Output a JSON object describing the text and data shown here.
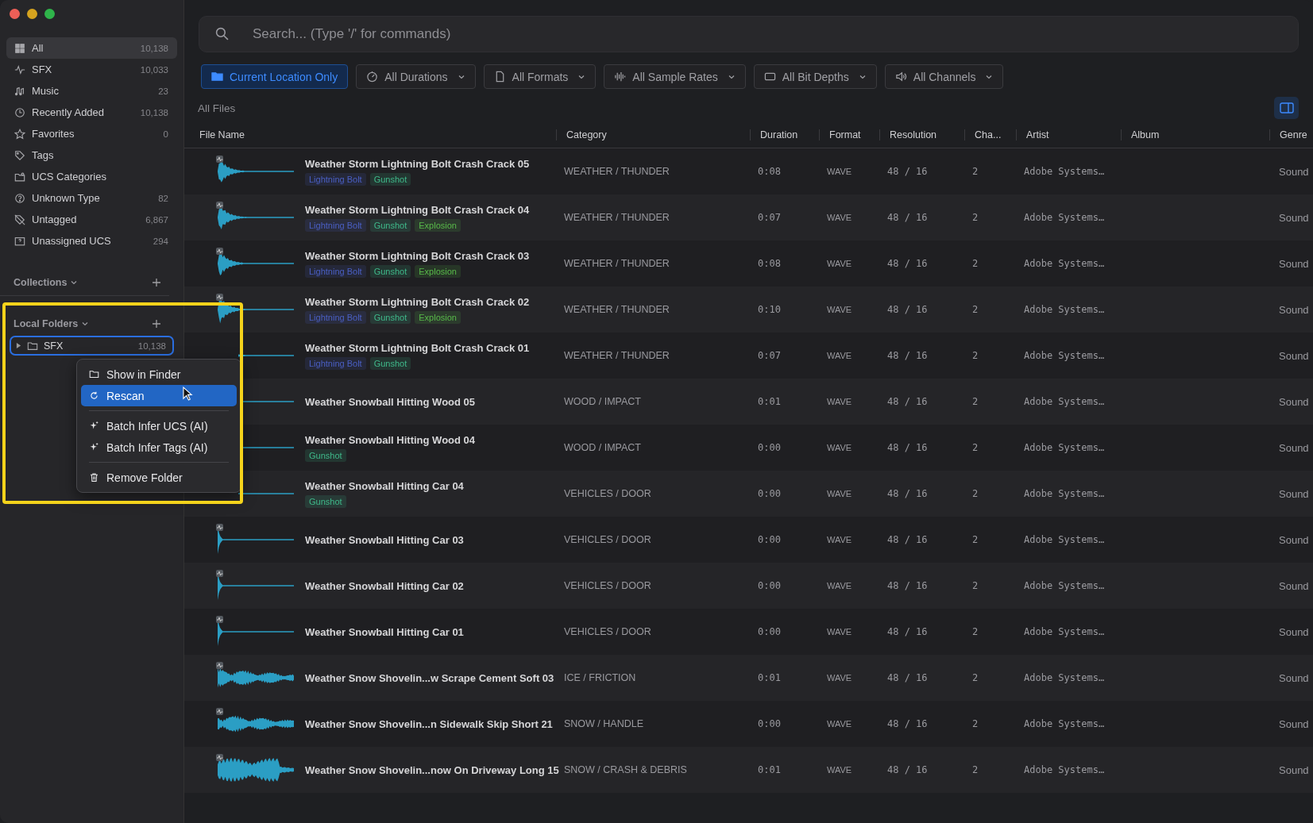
{
  "sidebar": {
    "items": [
      {
        "label": "All",
        "count": "10,138",
        "selected": true
      },
      {
        "label": "SFX",
        "count": "10,033",
        "selected": false
      },
      {
        "label": "Music",
        "count": "23",
        "selected": false
      },
      {
        "label": "Recently Added",
        "count": "10,138",
        "selected": false
      },
      {
        "label": "Favorites",
        "count": "0",
        "selected": false
      },
      {
        "label": "Tags",
        "selected": false
      },
      {
        "label": "UCS Categories",
        "selected": false
      },
      {
        "label": "Unknown Type",
        "count": "82",
        "selected": false
      },
      {
        "label": "Untagged",
        "count": "6,867",
        "selected": false
      },
      {
        "label": "Unassigned UCS",
        "count": "294",
        "selected": false
      }
    ],
    "collections": {
      "title": "Collections"
    },
    "local_folders": {
      "title": "Local Folders",
      "folders": [
        {
          "label": "SFX",
          "count": "10,138",
          "selected": true,
          "expanded": false
        }
      ]
    }
  },
  "context_menu": {
    "groups": [
      [
        {
          "label": "Show in Finder",
          "selected": false
        },
        {
          "label": "Rescan",
          "selected": true
        }
      ],
      [
        {
          "label": "Batch Infer UCS (AI)",
          "selected": false
        },
        {
          "label": "Batch Infer Tags (AI)",
          "selected": false
        }
      ],
      [
        {
          "label": "Remove Folder",
          "selected": false
        }
      ]
    ]
  },
  "search": {
    "placeholder": "Search... (Type '/' for commands)"
  },
  "filters": [
    {
      "label": "Current Location Only",
      "selected": true
    },
    {
      "label": "All Durations",
      "selected": false
    },
    {
      "label": "All Formats",
      "selected": false
    },
    {
      "label": "All Sample Rates",
      "selected": false
    },
    {
      "label": "All Bit Depths",
      "selected": false
    },
    {
      "label": "All Channels",
      "selected": false
    }
  ],
  "section_title": "All Files",
  "table": {
    "columns": [
      "File Name",
      "Category",
      "Duration",
      "Format",
      "Resolution",
      "Cha...",
      "Artist",
      "Album",
      "Genre"
    ],
    "rows": [
      {
        "name": "Weather Storm Lightning Bolt Crash Crack 05",
        "tags": [
          {
            "label": "Lightning Bolt",
            "color": "#4a5fc4"
          },
          {
            "label": "Gunshot",
            "color": "#3fb98a"
          }
        ],
        "category": "WEATHER / THUNDER",
        "duration": "0:08",
        "format": "WAVE",
        "resolution": "48 / 16",
        "channels": "2",
        "artist": "Adobe Systems…",
        "genre": "Sound"
      },
      {
        "name": "Weather Storm Lightning Bolt Crash Crack 04",
        "tags": [
          {
            "label": "Lightning Bolt",
            "color": "#4a5fc4"
          },
          {
            "label": "Gunshot",
            "color": "#3fb98a"
          },
          {
            "label": "Explosion",
            "color": "#58b94a"
          }
        ],
        "category": "WEATHER / THUNDER",
        "duration": "0:07",
        "format": "WAVE",
        "resolution": "48 / 16",
        "channels": "2",
        "artist": "Adobe Systems…",
        "genre": "Sound"
      },
      {
        "name": "Weather Storm Lightning Bolt Crash Crack 03",
        "tags": [
          {
            "label": "Lightning Bolt",
            "color": "#4a5fc4"
          },
          {
            "label": "Gunshot",
            "color": "#3fb98a"
          },
          {
            "label": "Explosion",
            "color": "#58b94a"
          }
        ],
        "category": "WEATHER / THUNDER",
        "duration": "0:08",
        "format": "WAVE",
        "resolution": "48 / 16",
        "channels": "2",
        "artist": "Adobe Systems…",
        "genre": "Sound"
      },
      {
        "name": "Weather Storm Lightning Bolt Crash Crack 02",
        "tags": [
          {
            "label": "Lightning Bolt",
            "color": "#4a5fc4"
          },
          {
            "label": "Gunshot",
            "color": "#3fb98a"
          },
          {
            "label": "Explosion",
            "color": "#58b94a"
          }
        ],
        "category": "WEATHER / THUNDER",
        "duration": "0:10",
        "format": "WAVE",
        "resolution": "48 / 16",
        "channels": "2",
        "artist": "Adobe Systems…",
        "genre": "Sound"
      },
      {
        "name": "Weather Storm Lightning Bolt Crash Crack 01",
        "tags": [
          {
            "label": "Lightning Bolt",
            "color": "#4a5fc4"
          },
          {
            "label": "Gunshot",
            "color": "#3fb98a"
          }
        ],
        "category": "WEATHER / THUNDER",
        "duration": "0:07",
        "format": "WAVE",
        "resolution": "48 / 16",
        "channels": "2",
        "artist": "Adobe Systems…",
        "genre": "Sound"
      },
      {
        "name": "Weather Snowball Hitting Wood 05",
        "tags": [],
        "category": "WOOD / IMPACT",
        "duration": "0:01",
        "format": "WAVE",
        "resolution": "48 / 16",
        "channels": "2",
        "artist": "Adobe Systems…",
        "genre": "Sound"
      },
      {
        "name": "Weather Snowball Hitting Wood 04",
        "tags": [
          {
            "label": "Gunshot",
            "color": "#3fb98a"
          }
        ],
        "category": "WOOD / IMPACT",
        "duration": "0:00",
        "format": "WAVE",
        "resolution": "48 / 16",
        "channels": "2",
        "artist": "Adobe Systems…",
        "genre": "Sound"
      },
      {
        "name": "Weather Snowball Hitting Car 04",
        "tags": [
          {
            "label": "Gunshot",
            "color": "#3fb98a"
          }
        ],
        "category": "VEHICLES / DOOR",
        "duration": "0:00",
        "format": "WAVE",
        "resolution": "48 / 16",
        "channels": "2",
        "artist": "Adobe Systems…",
        "genre": "Sound"
      },
      {
        "name": "Weather Snowball Hitting Car 03",
        "tags": [],
        "category": "VEHICLES / DOOR",
        "duration": "0:00",
        "format": "WAVE",
        "resolution": "48 / 16",
        "channels": "2",
        "artist": "Adobe Systems…",
        "genre": "Sound"
      },
      {
        "name": "Weather Snowball Hitting Car 02",
        "tags": [],
        "category": "VEHICLES / DOOR",
        "duration": "0:00",
        "format": "WAVE",
        "resolution": "48 / 16",
        "channels": "2",
        "artist": "Adobe Systems…",
        "genre": "Sound"
      },
      {
        "name": "Weather Snowball Hitting Car 01",
        "tags": [],
        "category": "VEHICLES / DOOR",
        "duration": "0:00",
        "format": "WAVE",
        "resolution": "48 / 16",
        "channels": "2",
        "artist": "Adobe Systems…",
        "genre": "Sound"
      },
      {
        "name": "Weather Snow Shovelin...w Scrape Cement Soft 03",
        "tags": [],
        "category": "ICE / FRICTION",
        "duration": "0:01",
        "format": "WAVE",
        "resolution": "48 / 16",
        "channels": "2",
        "artist": "Adobe Systems…",
        "genre": "Sound"
      },
      {
        "name": "Weather Snow Shovelin...n Sidewalk Skip Short 21",
        "tags": [],
        "category": "SNOW / HANDLE",
        "duration": "0:00",
        "format": "WAVE",
        "resolution": "48 / 16",
        "channels": "2",
        "artist": "Adobe Systems…",
        "genre": "Sound"
      },
      {
        "name": "Weather Snow Shovelin...now On Driveway Long 15",
        "tags": [],
        "category": "SNOW / CRASH & DEBRIS",
        "duration": "0:01",
        "format": "WAVE",
        "resolution": "48 / 16",
        "channels": "2",
        "artist": "Adobe Systems…",
        "genre": "Sound"
      }
    ]
  }
}
